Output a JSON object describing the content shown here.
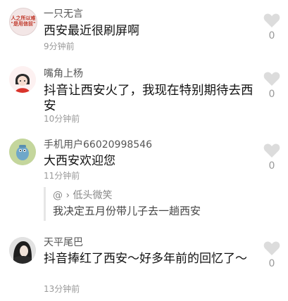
{
  "comments": [
    {
      "username": "一只无言",
      "content": "西安最近很刷屏啊",
      "time": "9分钟前",
      "likes": "0",
      "avatar_text": "人之所以难\n\"是用信前\""
    },
    {
      "username": "嘴角上杨",
      "content": "抖音让西安火了，我现在特别期待去西安",
      "time": "10分钟前",
      "likes": "0"
    },
    {
      "username": "手机用户66020998546",
      "content": "大西安欢迎您",
      "time": "11分钟前",
      "likes": "0",
      "reply": {
        "author": "@ › 低头微笑",
        "text": "我决定五月份带儿子去一趟西安"
      }
    },
    {
      "username": "天平尾巴",
      "content": "抖音捧红了西安～好多年前的回忆了～",
      "time": "13分钟前",
      "likes": "0"
    }
  ],
  "icons": {
    "like": "heart-icon"
  },
  "colors": {
    "heart": "#dcdcdc"
  }
}
